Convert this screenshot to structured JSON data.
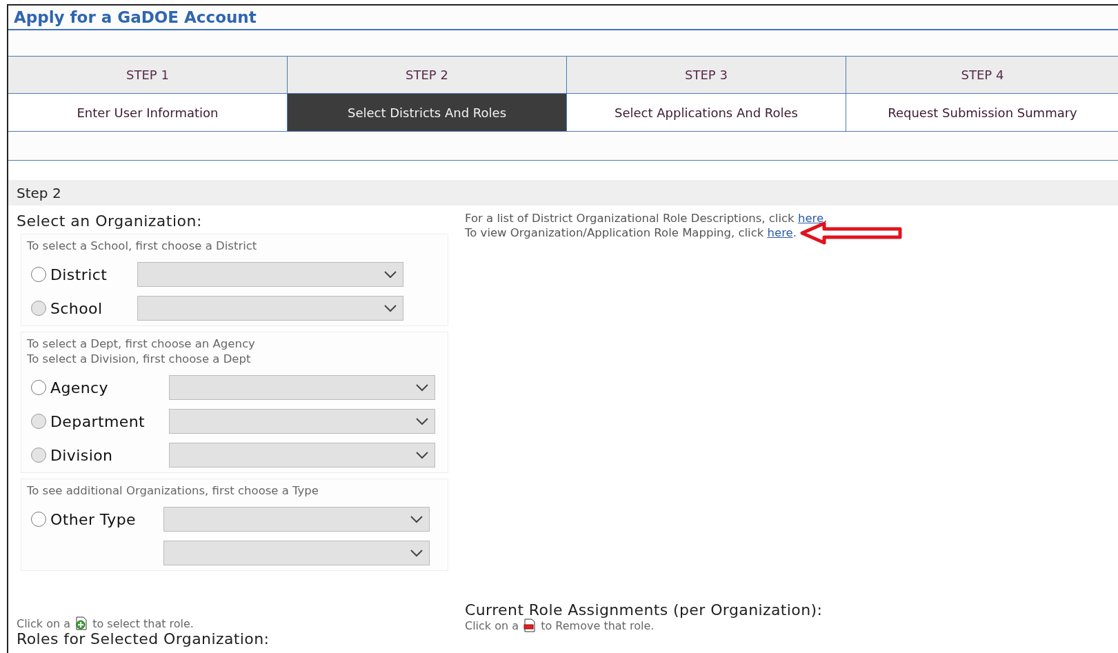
{
  "window": {
    "title": "Apply for a GaDOE Account"
  },
  "steps": [
    {
      "step": "STEP 1",
      "label": "Enter User Information",
      "selected": false
    },
    {
      "step": "STEP 2",
      "label": "Select Districts And Roles",
      "selected": true
    },
    {
      "step": "STEP 3",
      "label": "Select Applications And Roles",
      "selected": false
    },
    {
      "step": "STEP 4",
      "label": "Request Submission Summary",
      "selected": false
    }
  ],
  "section_title": "Step 2",
  "organization": {
    "heading": "Select an Organization:",
    "groups": [
      {
        "hints": [
          "To select a School, first choose a District"
        ],
        "options": [
          {
            "label": "District",
            "selected": false,
            "disabled": false,
            "kind": "single"
          },
          {
            "label": "School",
            "selected": false,
            "disabled": true,
            "kind": "single"
          }
        ]
      },
      {
        "hints": [
          "To select a Dept, first choose an Agency",
          "To select a Division, first choose a Dept"
        ],
        "options": [
          {
            "label": "Agency",
            "selected": false,
            "disabled": false,
            "kind": "single"
          },
          {
            "label": "Department",
            "selected": false,
            "disabled": true,
            "kind": "single"
          },
          {
            "label": "Division",
            "selected": false,
            "disabled": true,
            "kind": "single"
          }
        ]
      },
      {
        "hints": [
          "To see additional Organizations, first choose a Type"
        ],
        "options": [
          {
            "label": "Other Type",
            "selected": false,
            "disabled": false,
            "kind": "double"
          }
        ]
      }
    ]
  },
  "help_links": [
    {
      "before": "For a list of District Organizational Role Descriptions, click ",
      "link": "here",
      "after": ".",
      "pointer_arrow": false
    },
    {
      "before": "To view Organization/Application Role Mapping, click ",
      "link": "here",
      "after": ".",
      "pointer_arrow": true
    }
  ],
  "roles": {
    "hint_before": "Click on a",
    "hint_after": "to select that role.",
    "heading": "Roles for Selected Organization:"
  },
  "assignments": {
    "heading": "Current Role Assignments (per Organization):",
    "hint_before": "Click on a",
    "hint_after": "to Remove that role."
  }
}
